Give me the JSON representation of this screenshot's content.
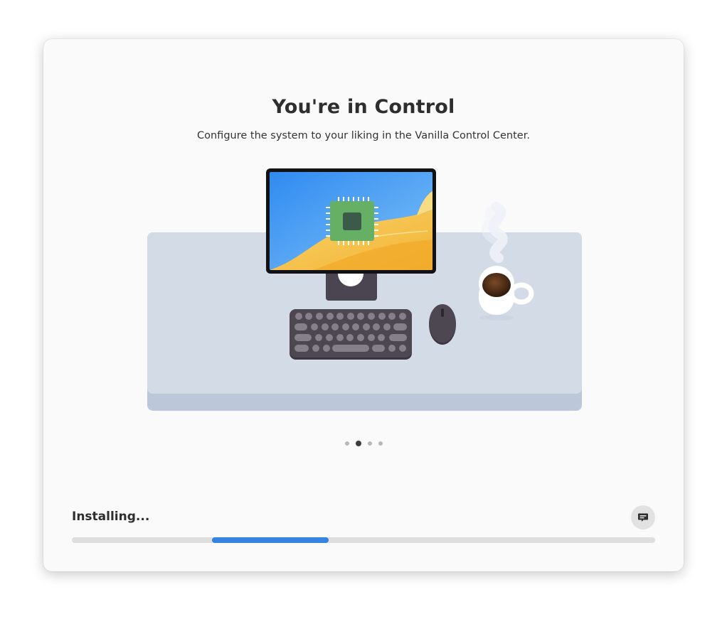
{
  "slide": {
    "title": "You're in Control",
    "description": "Configure the system to your liking in the Vanilla Control Center.",
    "current_page": 2,
    "total_pages": 4
  },
  "footer": {
    "status_label": "Installing...",
    "console_button_icon": "terminal-chat-icon",
    "progress_indicator": "indeterminate",
    "progress_segment": {
      "start_fraction": 0.24,
      "length_fraction": 0.2
    }
  },
  "colors": {
    "accent": "#3584e4",
    "window_bg": "#fafafa",
    "title_text": "#2e2e2e"
  }
}
